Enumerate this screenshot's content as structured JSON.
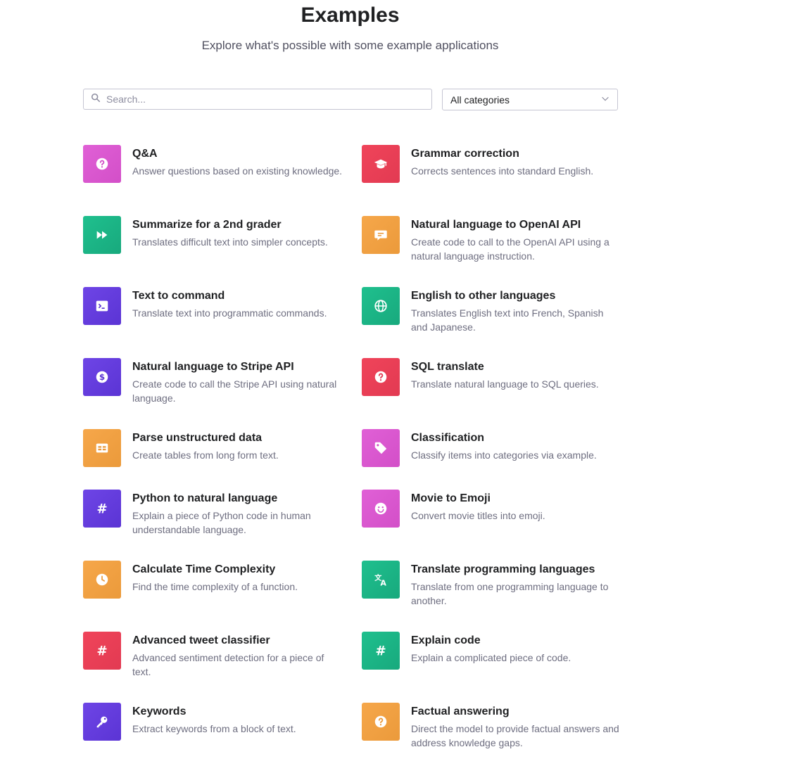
{
  "header": {
    "title": "Examples",
    "subtitle": "Explore what's possible with some example applications"
  },
  "filters": {
    "search_placeholder": "Search...",
    "category_selected": "All categories"
  },
  "colors": {
    "pink": "#d34fc8",
    "red": "#e23a52",
    "green": "#18a97d",
    "orange": "#eb9a3b",
    "purple": "#5b34d4"
  },
  "examples": [
    {
      "title": "Q&A",
      "description": "Answer questions based on existing knowledge.",
      "icon": "question-circle-icon",
      "color": "pink"
    },
    {
      "title": "Grammar correction",
      "description": "Corrects sentences into standard English.",
      "icon": "graduation-cap-icon",
      "color": "red"
    },
    {
      "title": "Summarize for a 2nd grader",
      "description": "Translates difficult text into simpler concepts.",
      "icon": "fast-forward-icon",
      "color": "green"
    },
    {
      "title": "Natural language to OpenAI API",
      "description": "Create code to call to the OpenAI API using a natural language instruction.",
      "icon": "chat-bubble-icon",
      "color": "orange"
    },
    {
      "title": "Text to command",
      "description": "Translate text into programmatic commands.",
      "icon": "terminal-icon",
      "color": "purple"
    },
    {
      "title": "English to other languages",
      "description": "Translates English text into French, Spanish and Japanese.",
      "icon": "globe-icon",
      "color": "green"
    },
    {
      "title": "Natural language to Stripe API",
      "description": "Create code to call the Stripe API using natural language.",
      "icon": "dollar-circle-icon",
      "color": "purple"
    },
    {
      "title": "SQL translate",
      "description": "Translate natural language to SQL queries.",
      "icon": "question-circle-icon",
      "color": "red"
    },
    {
      "title": "Parse unstructured data",
      "description": "Create tables from long form text.",
      "icon": "table-icon",
      "color": "orange"
    },
    {
      "title": "Classification",
      "description": "Classify items into categories via example.",
      "icon": "tag-icon",
      "color": "pink"
    },
    {
      "title": "Python to natural language",
      "description": "Explain a piece of Python code in human understandable language.",
      "icon": "hashtag-icon",
      "color": "purple"
    },
    {
      "title": "Movie to Emoji",
      "description": "Convert movie titles into emoji.",
      "icon": "smiley-icon",
      "color": "pink"
    },
    {
      "title": "Calculate Time Complexity",
      "description": "Find the time complexity of a function.",
      "icon": "clock-icon",
      "color": "orange"
    },
    {
      "title": "Translate programming languages",
      "description": "Translate from one programming language to another.",
      "icon": "translate-icon",
      "color": "green"
    },
    {
      "title": "Advanced tweet classifier",
      "description": "Advanced sentiment detection for a piece of text.",
      "icon": "hashtag-icon",
      "color": "red"
    },
    {
      "title": "Explain code",
      "description": "Explain a complicated piece of code.",
      "icon": "hashtag-icon",
      "color": "green"
    },
    {
      "title": "Keywords",
      "description": "Extract keywords from a block of text.",
      "icon": "key-icon",
      "color": "purple"
    },
    {
      "title": "Factual answering",
      "description": "Direct the model to provide factual answers and address knowledge gaps.",
      "icon": "question-circle-icon",
      "color": "orange"
    }
  ]
}
